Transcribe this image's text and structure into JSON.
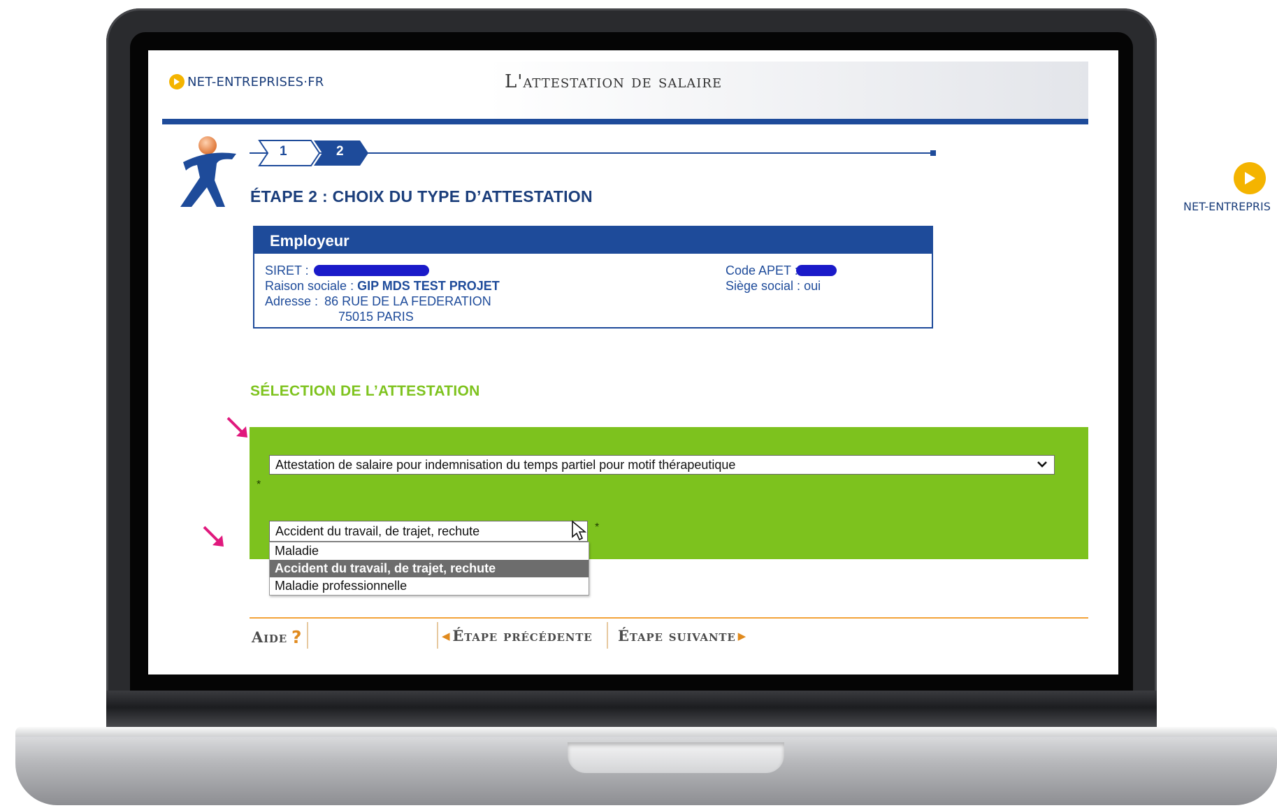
{
  "brand": {
    "name": "NET-ENTREPRISES·FR",
    "side_name": "NET-ENTREPRIS"
  },
  "header": {
    "title": "L'attestation de salaire"
  },
  "stepper": {
    "steps": [
      "1",
      "2"
    ],
    "current": 2
  },
  "step_title": "ÉTAPE 2 : CHOIX DU TYPE D’ATTESTATION",
  "employer": {
    "heading": "Employeur",
    "siret_label": "SIRET :",
    "raison_label": "Raison sociale :",
    "raison_value": "GIP MDS TEST PROJET",
    "adresse_label": "Adresse :",
    "adresse_line1": "86 RUE DE LA FEDERATION",
    "adresse_line2": "75015 PARIS",
    "apet_label": "Code APET :",
    "siege_label": "Siège social :",
    "siege_value": "oui"
  },
  "selection": {
    "title": "SÉLECTION DE L’ATTESTATION",
    "attestation_type": "Attestation de salaire pour indemnisation du temps partiel pour motif thérapeutique",
    "motif_selected": "Accident du travail, de trajet, rechute",
    "required_marker": "*",
    "motif_options": [
      "Maladie",
      "Accident du travail, de trajet, rechute",
      "Maladie professionnelle"
    ],
    "highlighted_option_index": 1
  },
  "footer": {
    "help_label": "Aide",
    "help_icon": "?",
    "prev_label": "Étape précédente",
    "next_label": "Étape suivante"
  },
  "colors": {
    "navy": "#1e4b9a",
    "green_panel": "#7dc21e",
    "green_title": "#7ec31e",
    "accent_orange": "#e08a1e",
    "arrow_pink": "#e0197d",
    "brand_yellow": "#f4b400"
  }
}
